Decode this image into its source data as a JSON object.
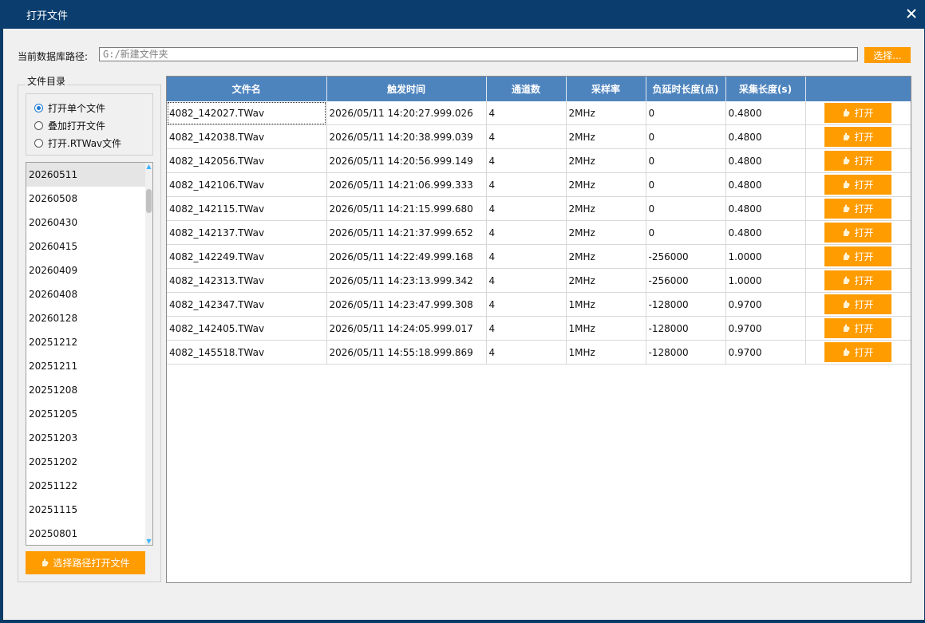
{
  "window": {
    "title": "打开文件"
  },
  "path": {
    "label": "当前数据库路径:",
    "value": "G:/新建文件夹",
    "choose_label": "选择..."
  },
  "directory": {
    "title": "文件目录",
    "options": [
      "打开单个文件",
      "叠加打开文件",
      "打开.RTWav文件"
    ],
    "selected_option": 0,
    "dates": [
      "20260511",
      "20260508",
      "20260430",
      "20260415",
      "20260409",
      "20260408",
      "20260128",
      "20251212",
      "20251211",
      "20251208",
      "20251205",
      "20251203",
      "20251202",
      "20251122",
      "20251115",
      "20250801"
    ],
    "selected_date": "20260511",
    "open_path_label": "选择路径打开文件"
  },
  "table": {
    "columns": [
      "文件名",
      "触发时间",
      "通道数",
      "采样率",
      "负延时长度(点)",
      "采集长度(s)",
      ""
    ],
    "open_label": "打开",
    "header_color": "#4e84be",
    "button_color": "#ff9c00",
    "rows": [
      [
        "4082_142027.TWav",
        "2026/05/11 14:20:27.999.026",
        "4",
        "2MHz",
        "0",
        "0.4800"
      ],
      [
        "4082_142038.TWav",
        "2026/05/11 14:20:38.999.039",
        "4",
        "2MHz",
        "0",
        "0.4800"
      ],
      [
        "4082_142056.TWav",
        "2026/05/11 14:20:56.999.149",
        "4",
        "2MHz",
        "0",
        "0.4800"
      ],
      [
        "4082_142106.TWav",
        "2026/05/11 14:21:06.999.333",
        "4",
        "2MHz",
        "0",
        "0.4800"
      ],
      [
        "4082_142115.TWav",
        "2026/05/11 14:21:15.999.680",
        "4",
        "2MHz",
        "0",
        "0.4800"
      ],
      [
        "4082_142137.TWav",
        "2026/05/11 14:21:37.999.652",
        "4",
        "2MHz",
        "0",
        "0.4800"
      ],
      [
        "4082_142249.TWav",
        "2026/05/11 14:22:49.999.168",
        "4",
        "2MHz",
        "-256000",
        "1.0000"
      ],
      [
        "4082_142313.TWav",
        "2026/05/11 14:23:13.999.342",
        "4",
        "2MHz",
        "-256000",
        "1.0000"
      ],
      [
        "4082_142347.TWav",
        "2026/05/11 14:23:47.999.308",
        "4",
        "1MHz",
        "-128000",
        "0.9700"
      ],
      [
        "4082_142405.TWav",
        "2026/05/11 14:24:05.999.017",
        "4",
        "1MHz",
        "-128000",
        "0.9700"
      ],
      [
        "4082_145518.TWav",
        "2026/05/11 14:55:18.999.869",
        "4",
        "1MHz",
        "-128000",
        "0.9700"
      ]
    ]
  }
}
